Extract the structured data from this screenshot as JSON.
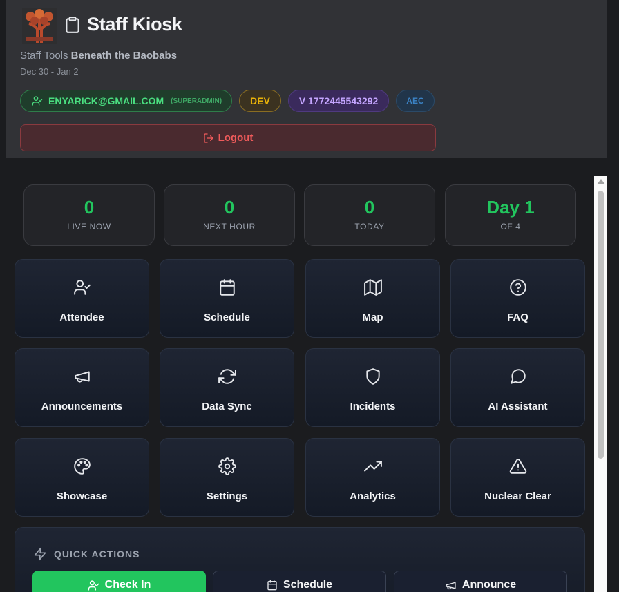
{
  "header": {
    "title": "Staff Kiosk",
    "subtitle_prefix": "Staff Tools",
    "event_name": "Beneath the Baobabs",
    "dates": "Dec 30 - Jan 2",
    "user_email": "ENYARICK@GMAIL.COM",
    "user_role": "(SUPERADMIN)",
    "env_badge": "DEV",
    "version_badge": "V 1772445543292",
    "org_badge": "AEC",
    "logout_label": "Logout"
  },
  "stats": [
    {
      "value": "0",
      "label": "LIVE NOW"
    },
    {
      "value": "0",
      "label": "NEXT HOUR"
    },
    {
      "value": "0",
      "label": "TODAY"
    },
    {
      "value": "Day 1",
      "label": "OF 4"
    }
  ],
  "tiles": [
    {
      "label": "Attendee",
      "icon": "user-check-icon"
    },
    {
      "label": "Schedule",
      "icon": "calendar-icon"
    },
    {
      "label": "Map",
      "icon": "map-icon"
    },
    {
      "label": "FAQ",
      "icon": "help-circle-icon"
    },
    {
      "label": "Announcements",
      "icon": "megaphone-icon"
    },
    {
      "label": "Data Sync",
      "icon": "refresh-icon"
    },
    {
      "label": "Incidents",
      "icon": "shield-icon"
    },
    {
      "label": "AI Assistant",
      "icon": "message-circle-icon"
    },
    {
      "label": "Showcase",
      "icon": "palette-icon"
    },
    {
      "label": "Settings",
      "icon": "gear-icon"
    },
    {
      "label": "Analytics",
      "icon": "trending-up-icon"
    },
    {
      "label": "Nuclear Clear",
      "icon": "alert-triangle-icon"
    }
  ],
  "quick_actions": {
    "title": "QUICK ACTIONS",
    "buttons": [
      {
        "label": "Check In",
        "icon": "user-check-icon"
      },
      {
        "label": "Schedule",
        "icon": "calendar-icon"
      },
      {
        "label": "Announce",
        "icon": "megaphone-icon"
      }
    ]
  },
  "colors": {
    "accent_green": "#22c55e",
    "logout_red": "#f05b5b",
    "dev_yellow": "#eab308",
    "version_purple": "#c4a5ff"
  }
}
